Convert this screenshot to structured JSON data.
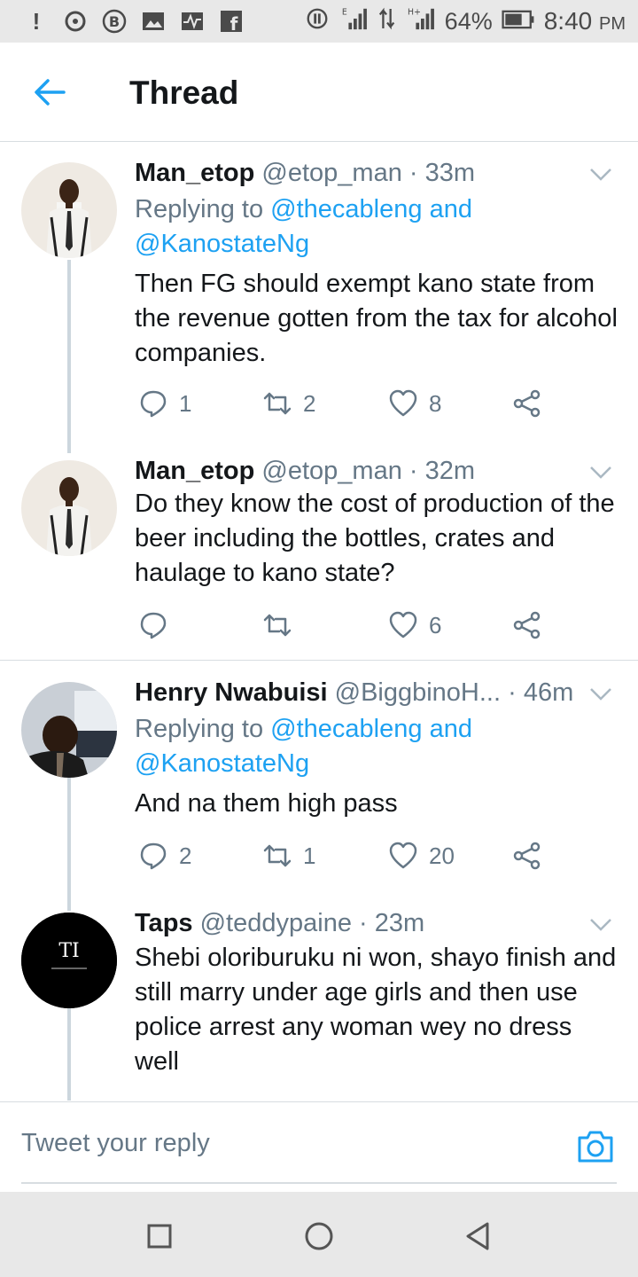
{
  "status_bar": {
    "battery": "64%",
    "time": "8:40",
    "ampm": "PM",
    "icons": [
      "alert-icon",
      "whatsapp-icon",
      "b-icon",
      "gallery-icon",
      "pulse-icon",
      "facebook-icon",
      "hotspot-icon",
      "signal-e-icon",
      "data-arrows-icon",
      "signal-h-icon",
      "battery-icon"
    ]
  },
  "header": {
    "title": "Thread",
    "back_icon": "back-arrow-icon"
  },
  "tweets": [
    {
      "name": "Man_etop",
      "handle": "@etop_man",
      "time": "· 33m",
      "replying_prefix": "Replying to",
      "replying_mention1": "@thecableng",
      "replying_and": "and",
      "replying_mention2": "@KanostateNg",
      "body": "Then FG should exempt kano state from the revenue gotten from the tax for alcohol companies.",
      "replies": "1",
      "retweets": "2",
      "likes": "8"
    },
    {
      "name": "Man_etop",
      "handle": "@etop_man",
      "time": "· 32m",
      "body": "Do they know the cost of production of the beer including the bottles, crates and haulage to kano state?",
      "replies": "",
      "retweets": "",
      "likes": "6"
    },
    {
      "name": "Henry Nwabuisi",
      "handle": "@BiggbinoH...",
      "time": "· 46m",
      "replying_prefix": "Replying to",
      "replying_mention1": "@thecableng",
      "replying_and": "and",
      "replying_mention2": "@KanostateNg",
      "body": "And na them high pass",
      "replies": "2",
      "retweets": "1",
      "likes": "20"
    },
    {
      "name": "Taps",
      "handle": "@teddypaine",
      "time": "· 23m",
      "body": "Shebi oloriburuku ni won, shayo finish and still marry under age girls and then use police arrest any woman wey no dress well",
      "avatar_logo": "TI"
    }
  ],
  "reply_bar": {
    "placeholder": "Tweet your reply"
  },
  "colors": {
    "accent": "#1da1f2",
    "text": "#14171a",
    "secondary": "#657786",
    "divider": "#d8dde1",
    "system_bar": "#e8e8e8"
  }
}
